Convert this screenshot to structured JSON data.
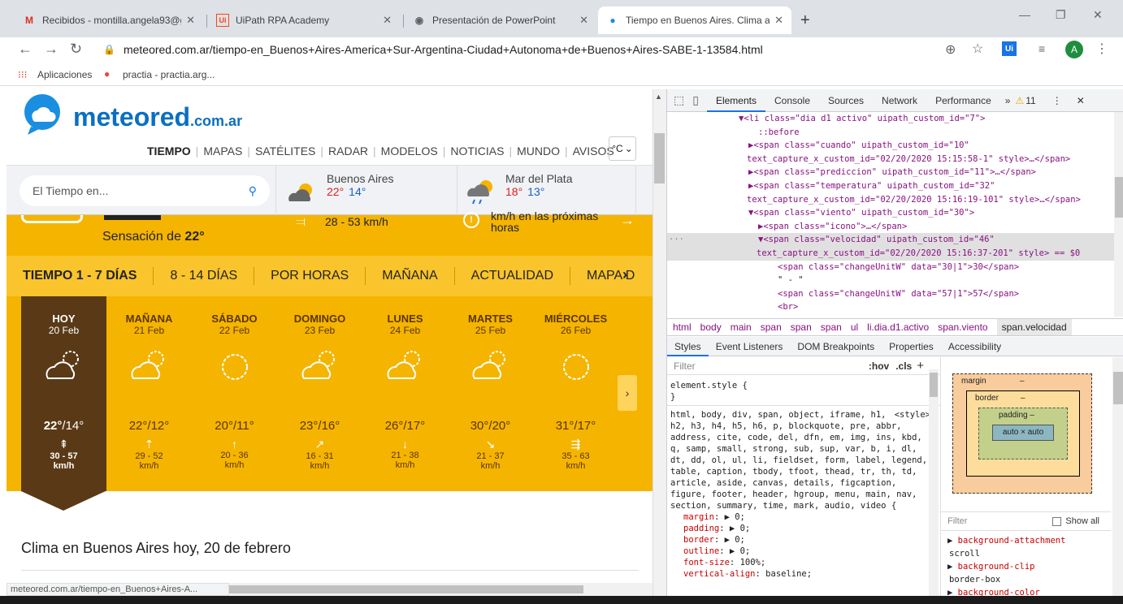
{
  "browser": {
    "tabs": [
      {
        "title": "Recibidos - montilla.angela93@g",
        "icon": "gmail-icon"
      },
      {
        "title": "UiPath RPA Academy",
        "icon": "uipath-icon"
      },
      {
        "title": "Presentación de PowerPoint",
        "icon": "globe-icon"
      },
      {
        "title": "Tiempo en Buenos Aires. Clima a",
        "icon": "meteored-icon"
      }
    ],
    "url": "meteored.com.ar/tiempo-en_Buenos+Aires-America+Sur-Argentina-Ciudad+Autonoma+de+Buenos+Aires-SABE-1-13584.html",
    "bookmarks": [
      "Aplicaciones",
      "practia - practia.arg..."
    ],
    "profile_initial": "A",
    "ext_label": "Ui"
  },
  "site": {
    "logo_main": "meteored",
    "logo_suffix": ".com.ar",
    "nav": [
      "TIEMPO",
      "MAPAS",
      "SATÉLITES",
      "RADAR",
      "MODELOS",
      "NOTICIAS",
      "MUNDO",
      "AVISOS"
    ],
    "unit": "°C",
    "search_placeholder": "El Tiempo en...",
    "cities": [
      {
        "name": "Buenos Aires",
        "hi": "22°",
        "lo": "14°"
      },
      {
        "name": "Mar del Plata",
        "hi": "18°",
        "lo": "13°"
      }
    ],
    "feels_label": "Sensación de",
    "feels_value": "22°",
    "wind_range": "28 - 53 km/h",
    "rain_note": "km/h en las próximas horas",
    "day_tabs": [
      "TIEMPO 1 - 7 DÍAS",
      "8 - 14 DÍAS",
      "POR HORAS",
      "MAÑANA",
      "ACTUALIDAD",
      "MAPA D"
    ],
    "days": [
      {
        "name": "HOY",
        "date": "20 Feb",
        "hi": "22°",
        "lo": "14°",
        "wind": "30 - 57",
        "unit": "km/h"
      },
      {
        "name": "MAÑANA",
        "date": "21 Feb",
        "hi": "22°",
        "lo": "12°",
        "wind": "29 - 52",
        "unit": "km/h"
      },
      {
        "name": "SÁBADO",
        "date": "22 Feb",
        "hi": "20°",
        "lo": "11°",
        "wind": "20 - 36",
        "unit": "km/h"
      },
      {
        "name": "DOMINGO",
        "date": "23 Feb",
        "hi": "23°",
        "lo": "16°",
        "wind": "16 - 31",
        "unit": "km/h"
      },
      {
        "name": "LUNES",
        "date": "24 Feb",
        "hi": "26°",
        "lo": "17°",
        "wind": "21 - 38",
        "unit": "km/h"
      },
      {
        "name": "MARTES",
        "date": "25 Feb",
        "hi": "30°",
        "lo": "20°",
        "wind": "21 - 37",
        "unit": "km/h"
      },
      {
        "name": "MIÉRCOLES",
        "date": "26 Feb",
        "hi": "31°",
        "lo": "17°",
        "wind": "35 - 63",
        "unit": "km/h"
      }
    ],
    "clima_title": "Clima en Buenos Aires hoy, 20 de febrero",
    "status_url": "meteored.com.ar/tiempo-en_Buenos+Aires-A..."
  },
  "devtools": {
    "tabs": [
      "Elements",
      "Console",
      "Sources",
      "Network",
      "Performance"
    ],
    "warnings": "11",
    "dom": [
      "▼<li class=\"dia d1 activo\" uipath_custom_id=\"7\">",
      "::before",
      "▶<span class=\"cuando\" uipath_custom_id=\"10\"",
      "text_capture_x_custom_id=\"02/20/2020 15:15:58-1\" style>…</span>",
      "▶<span class=\"prediccion\" uipath_custom_id=\"11\">…</span>",
      "▶<span class=\"temperatura\" uipath_custom_id=\"32\"",
      "text_capture_x_custom_id=\"02/20/2020 15:16:19-101\" style>…</span>",
      "▼<span class=\"viento\" uipath_custom_id=\"30\">",
      "▶<span class=\"icono\">…</span>",
      "▼<span class=\"velocidad\" uipath_custom_id=\"46\"",
      "text_capture_x_custom_id=\"02/20/2020 15:16:37-201\" style> == $0",
      "<span class=\"changeUnitW\" data=\"30|1\">30</span>",
      "\" - \"",
      "<span class=\"changeUnitW\" data=\"57|1\">57</span>",
      "<br>"
    ],
    "breadcrumbs": [
      "html",
      "body",
      "main",
      "span",
      "span",
      "span",
      "ul",
      "li.dia.d1.activo",
      "span.viento",
      "span.velocidad"
    ],
    "subtabs": [
      "Styles",
      "Event Listeners",
      "DOM Breakpoints",
      "Properties",
      "Accessibility"
    ],
    "filter_placeholder": "Filter",
    "hov": ":hov",
    "cls": ".cls",
    "element_style": "element.style {",
    "close_brace": "}",
    "ua_selector": "html, body, div, span, object, iframe, h1, h2, h3, h4, h5, h6, p, blockquote, pre, abbr, address, cite, code, del, dfn, em, img, ins, kbd, q, samp, small, strong, sub, sup, var, b, i, dl, dt, dd, ol, ul, li, fieldset, form, label, legend, table, caption, tbody, tfoot, thead, tr, th, td, article, aside, canvas, details, figcaption, figure, footer, header, hgroup, menu, main, nav, section, summary, time, mark, audio, video {",
    "ua_source": "<style>",
    "props": [
      {
        "name": "margin",
        "value": "▶ 0;"
      },
      {
        "name": "padding",
        "value": "▶ 0;"
      },
      {
        "name": "border",
        "value": "▶ 0;"
      },
      {
        "name": "outline",
        "value": "▶ 0;"
      },
      {
        "name": "font-size",
        "value": "100%;"
      },
      {
        "name": "vertical-align",
        "value": "baseline;"
      }
    ],
    "boxmodel": {
      "margin": "margin",
      "border": "border",
      "padding": "padding –",
      "content": "auto × auto",
      "dash": "–"
    },
    "computed_filter": "Filter",
    "show_all": "Show all",
    "computed": [
      {
        "name": "background-attachment",
        "value": "scroll"
      },
      {
        "name": "background-clip",
        "value": "border-box"
      },
      {
        "name": "background-color",
        "value": ""
      }
    ]
  }
}
